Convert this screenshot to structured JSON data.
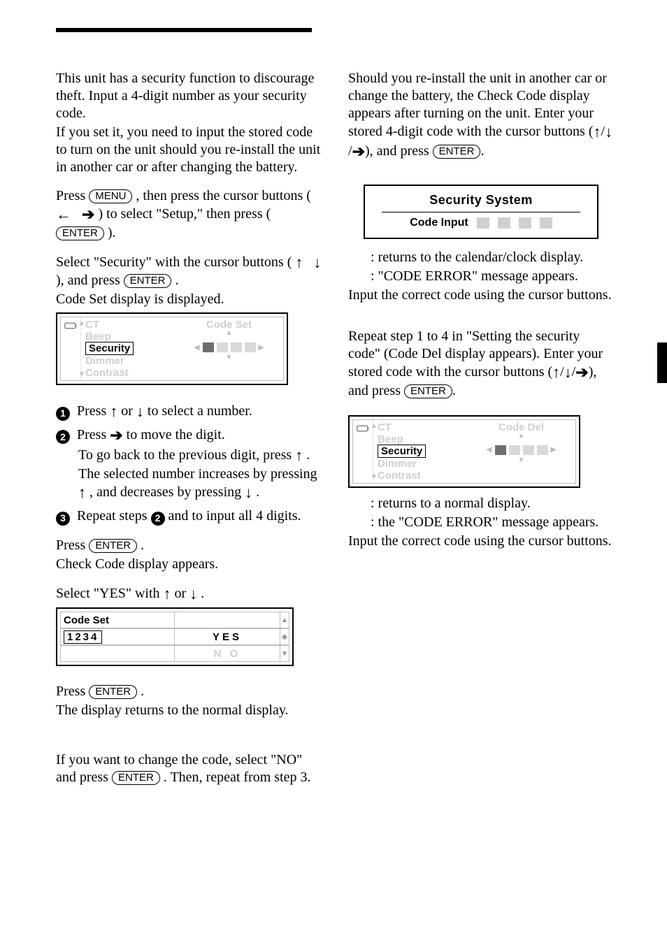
{
  "intro": {
    "p1": "This unit has a security function to discourage theft. Input a 4-digit number as your security code.",
    "p2": "If you set it, you need to input the stored code to turn on the unit should you re-install the unit in another car or after changing the battery."
  },
  "buttons": {
    "menu": "MENU",
    "enter": "ENTER"
  },
  "steps_left": {
    "press_menu_a": "Press ",
    "press_menu_b": ", then press the cursor buttons (",
    "press_menu_c": ") to select \"Setup,\" then press (",
    "press_menu_d": ").",
    "press_enter_sec_a": "Select \"Security\" with the cursor buttons (",
    "press_enter_sec_b": "), and press ",
    "press_enter_sec_c": ".",
    "codeset_shown": "Code Set display is displayed.",
    "menu_items": [
      "CT",
      "Beep",
      "Security",
      "Dimmer",
      "Contrast"
    ],
    "codeset_label": "Code Set",
    "step_ud_a": "Press ",
    "step_ud_b": " or ",
    "step_ud_c": " to select a number.",
    "step_right_a": "Press ",
    "step_right_b": " to move the digit.",
    "step_tip_a": "To go back to the previous digit, press ",
    "step_tip_b": ". The selected number increases by pressing ",
    "step_tip_c": ", and decreases by pressing ",
    "step_tip_d": ".",
    "repeat_a": "Repeat steps ",
    "repeat_b": " and ",
    "repeat_c": " to input all 4 digits.",
    "press_enter2_a": "Press ",
    "press_enter2_b": ".",
    "check_code": "Check Code display appears.",
    "select_yes_a": "Select \"YES\" with ",
    "select_yes_b": " or ",
    "select_yes_c": ".",
    "codeset_digits": "1234",
    "yes": "YES",
    "no": "N O",
    "press_enter3_a": "Press ",
    "press_enter3_b": ".",
    "returns_normal": "The display returns to the normal display.",
    "note_a": "If you want to change the code, select \"NO\" and press ",
    "note_b": ". Then, repeat from step 3."
  },
  "right": {
    "intro_a": "Should you re-install the unit in another car or change the battery, the Check Code display appears after turning on the unit. Enter your stored 4-digit code with the cursor buttons (",
    "intro_b": "), and press ",
    "intro_c": ".",
    "panel_title": "Security System",
    "panel_sub": "Code Input",
    "ok": ": returns to the calendar/clock display.",
    "ng": ": \"CODE ERROR\" message appears.",
    "retry": "Input the correct code using the cursor buttons.",
    "del_a": "Repeat step 1 to 4 in \"Setting the security code\" (Code Del display appears). Enter your stored code with the cursor buttons (",
    "del_b": "), and press ",
    "del_c": ".",
    "code_del_label": "Code Del",
    "ok2": ": returns to a normal display.",
    "ng2": ": the \"CODE ERROR\" message appears.",
    "retry2": "Input the correct code using the cursor buttons."
  }
}
